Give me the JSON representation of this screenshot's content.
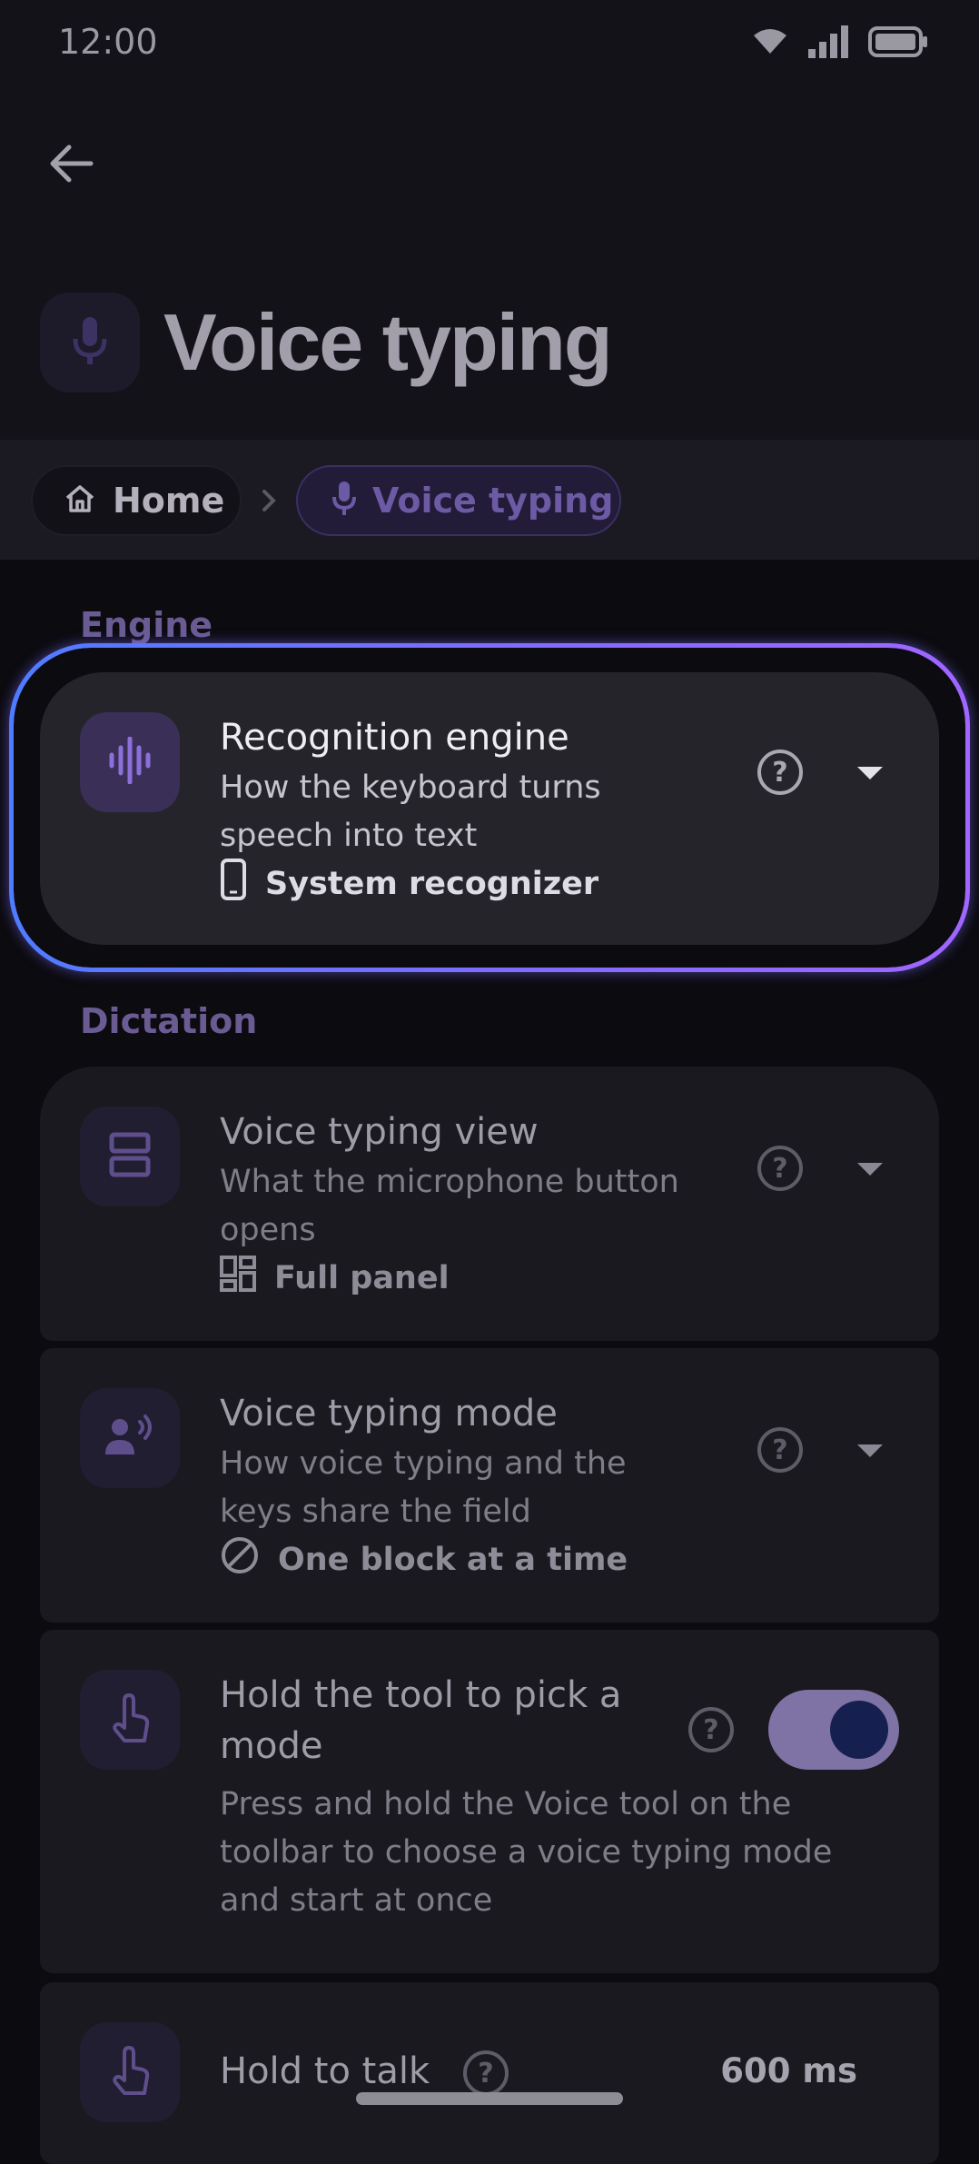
{
  "status": {
    "time": "12:00"
  },
  "page": {
    "title": "Voice typing"
  },
  "breadcrumb": {
    "home": "Home",
    "current": "Voice typing"
  },
  "sections": {
    "engine": "Engine",
    "dictation": "Dictation"
  },
  "settings": {
    "recognition_engine": {
      "title": "Recognition engine",
      "line1": "How the keyboard turns",
      "line2": "speech into text",
      "value": "System recognizer",
      "value_icon": "phone-icon"
    },
    "voice_typing_view": {
      "title": "Voice typing view",
      "line1": "What the microphone button",
      "line2": "opens",
      "value": "Full panel",
      "value_icon": "dashboard-icon"
    },
    "voice_typing_mode": {
      "title": "Voice typing mode",
      "line1": "How voice typing and the",
      "line2": "keys share the field",
      "value": "One block at a time",
      "value_icon": "block-icon"
    },
    "hold_tool_pick_mode": {
      "title_line1": "Hold the tool to pick a",
      "title_line2": "mode",
      "line1": "Press and hold the Voice tool on the",
      "line2": "toolbar to choose a voice typing mode",
      "line3": "and start at once",
      "enabled": true
    },
    "hold_to_talk": {
      "title": "Hold to talk",
      "value": "600 ms"
    }
  },
  "help_glyph": "?",
  "colors": {
    "accent": "#8a63ff",
    "ring_start": "#4e7cff",
    "toggle_track": "#7f72a4",
    "toggle_knob": "#162050"
  }
}
